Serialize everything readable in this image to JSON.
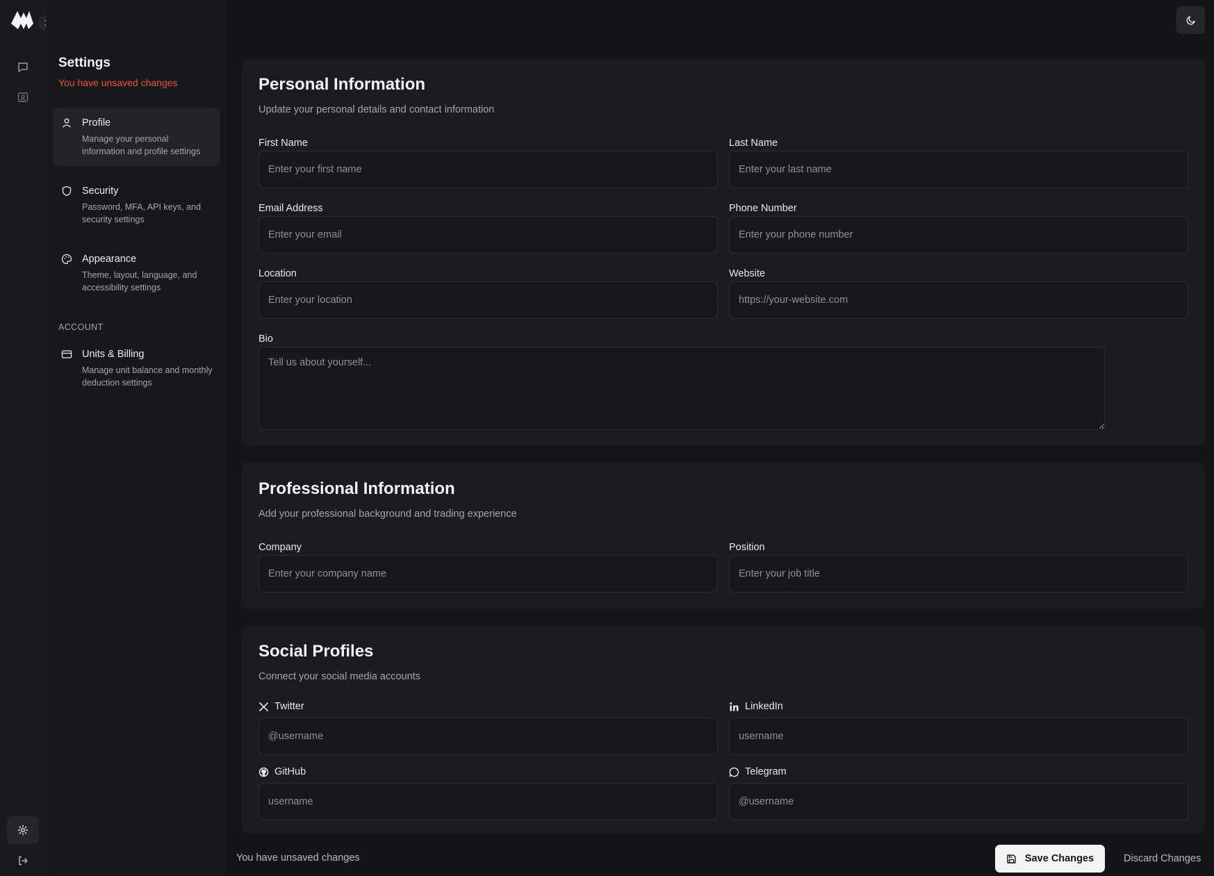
{
  "settings": {
    "title": "Settings",
    "unsaved_notice": "You have unsaved changes",
    "nav": [
      {
        "label": "Profile",
        "desc": "Manage your personal information and profile settings",
        "icon": "user-icon"
      },
      {
        "label": "Security",
        "desc": "Password, MFA, API keys, and security settings",
        "icon": "shield-icon"
      },
      {
        "label": "Appearance",
        "desc": "Theme, layout, language, and accessibility settings",
        "icon": "palette-icon"
      }
    ],
    "account_heading": "ACCOUNT",
    "account_nav": [
      {
        "label": "Units & Billing",
        "desc": "Manage unit balance and monthly deduction settings",
        "icon": "credit-card-icon"
      }
    ]
  },
  "personal": {
    "title": "Personal Information",
    "subtitle": "Update your personal details and contact information",
    "first_name": {
      "label": "First Name",
      "placeholder": "Enter your first name",
      "value": ""
    },
    "last_name": {
      "label": "Last Name",
      "placeholder": "Enter your last name",
      "value": ""
    },
    "email": {
      "label": "Email Address",
      "placeholder": "Enter your email",
      "value": ""
    },
    "phone": {
      "label": "Phone Number",
      "placeholder": "Enter your phone number",
      "value": ""
    },
    "location": {
      "label": "Location",
      "placeholder": "Enter your location",
      "value": ""
    },
    "website": {
      "label": "Website",
      "placeholder": "https://your-website.com",
      "value": ""
    },
    "bio": {
      "label": "Bio",
      "placeholder": "Tell us about yourself...",
      "value": ""
    }
  },
  "professional": {
    "title": "Professional Information",
    "subtitle": "Add your professional background and trading experience",
    "company": {
      "label": "Company",
      "placeholder": "Enter your company name",
      "value": ""
    },
    "position": {
      "label": "Position",
      "placeholder": "Enter your job title",
      "value": ""
    }
  },
  "social": {
    "title": "Social Profiles",
    "subtitle": "Connect your social media accounts",
    "twitter": {
      "label": "Twitter",
      "placeholder": "@username",
      "value": "",
      "icon": "x-twitter-icon"
    },
    "linkedin": {
      "label": "LinkedIn",
      "placeholder": "username",
      "value": "",
      "icon": "linkedin-icon"
    },
    "github": {
      "label": "GitHub",
      "placeholder": "username",
      "value": "",
      "icon": "github-icon"
    },
    "telegram": {
      "label": "Telegram",
      "placeholder": "@username",
      "value": "",
      "icon": "telegram-icon"
    }
  },
  "footer": {
    "unsaved_notice": "You have unsaved changes",
    "save_label": "Save Changes",
    "discard_label": "Discard Changes"
  },
  "colors": {
    "background": "#141518",
    "card": "#1b1c20",
    "warning": "#e8553a",
    "primary_button": "#f4f4f5"
  }
}
